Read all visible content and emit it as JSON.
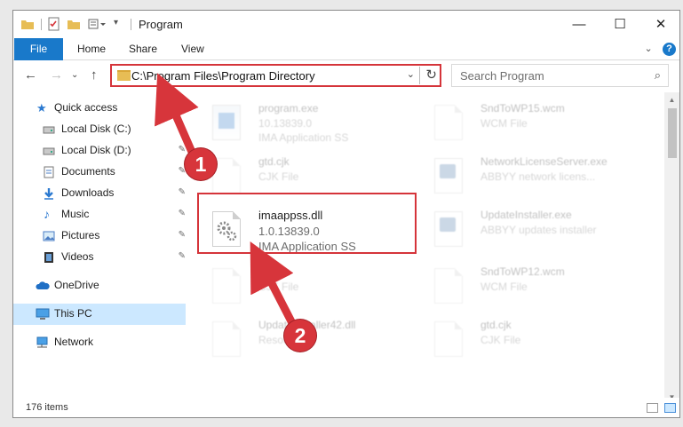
{
  "titlebar": {
    "title": "Program",
    "minimize": "—",
    "maximize": "☐",
    "close": "✕"
  },
  "ribbon": {
    "tabs": [
      "File",
      "Home",
      "Share",
      "View"
    ],
    "expand_glyph": "⌄",
    "help_glyph": "?"
  },
  "nav": {
    "back": "←",
    "forward": "→",
    "recent": "⌄",
    "up": "↑",
    "address": "C:\\Program Files\\Program Directory",
    "address_chevron": "⌄",
    "refresh": "↻",
    "search_placeholder": "Search Program",
    "search_glyph": "⌕"
  },
  "sidebar": {
    "items": [
      {
        "label": "Quick access",
        "icon": "star-icon",
        "pinned": false
      },
      {
        "label": "Local Disk (C:)",
        "icon": "drive-icon",
        "pinned": true
      },
      {
        "label": "Local Disk (D:)",
        "icon": "drive-icon",
        "pinned": true
      },
      {
        "label": "Documents",
        "icon": "documents-icon",
        "pinned": true
      },
      {
        "label": "Downloads",
        "icon": "download-icon",
        "pinned": true
      },
      {
        "label": "Music",
        "icon": "music-icon",
        "pinned": true
      },
      {
        "label": "Pictures",
        "icon": "pictures-icon",
        "pinned": true
      },
      {
        "label": "Videos",
        "icon": "videos-icon",
        "pinned": true
      },
      {
        "label": "OneDrive",
        "icon": "cloud-icon",
        "pinned": false
      },
      {
        "label": "This PC",
        "icon": "computer-icon",
        "pinned": false,
        "selected": true
      },
      {
        "label": "Network",
        "icon": "network-icon",
        "pinned": false
      }
    ],
    "pin_glyph": "📌"
  },
  "files": [
    {
      "name": "program.exe",
      "line2": "10.13839.0",
      "line3": "IMA Application SS",
      "faded": true,
      "icon": "installer-icon"
    },
    {
      "name": "SndToWP15.wcm",
      "line2": "WCM File",
      "line3": "",
      "faded": true,
      "icon": "document-icon"
    },
    {
      "name": "gtd.cjk",
      "line2": "CJK File",
      "line3": "",
      "faded": true,
      "icon": "document-icon"
    },
    {
      "name": "NetworkLicenseServer.exe",
      "line2": "ABBYY network licens...",
      "line3": "",
      "faded": true,
      "icon": "exe-icon"
    },
    {
      "name": "imaappss.dll",
      "line2": "1.0.13839.0",
      "line3": "IMA Application SS",
      "faded": false,
      "icon": "dll-gear-icon"
    },
    {
      "name": "UpdateInstaller.exe",
      "line2": "ABBYY updates installer",
      "line3": "",
      "faded": true,
      "icon": "exe-icon"
    },
    {
      "name": "gtd.cjk",
      "line2": "CJK File",
      "line3": "",
      "faded": true,
      "icon": "document-icon"
    },
    {
      "name": "SndToWP12.wcm",
      "line2": "WCM File",
      "line3": "",
      "faded": true,
      "icon": "document-icon"
    },
    {
      "name": "UpdateInstaller42.dll",
      "line2": "Resource",
      "line3": "",
      "faded": true,
      "icon": "dll-gear-icon"
    },
    {
      "name": "gtd.cjk",
      "line2": "CJK File",
      "line3": "",
      "faded": true,
      "icon": "document-icon"
    }
  ],
  "status": {
    "item_count": "176 items"
  },
  "annotations": {
    "step1": "1",
    "step2": "2",
    "accent": "#d5343a"
  },
  "colors": {
    "file_tab": "#1979ca",
    "selection": "#cce8ff"
  }
}
